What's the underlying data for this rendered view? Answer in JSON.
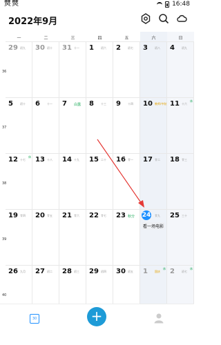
{
  "status": {
    "left_text": "㸈 㸈",
    "time": "16:48"
  },
  "header": {
    "title": "2022年9月"
  },
  "weekdays": [
    "一",
    "二",
    "三",
    "四",
    "五",
    "六",
    "日"
  ],
  "week_numbers": [
    "36",
    "37",
    "38",
    "39",
    "40"
  ],
  "cells": [
    {
      "day": "29",
      "lunar": "初九",
      "dim": true
    },
    {
      "day": "30",
      "lunar": "初十",
      "dim": true
    },
    {
      "day": "31",
      "lunar": "十一",
      "dim": true
    },
    {
      "day": "1",
      "lunar": "初六"
    },
    {
      "day": "2",
      "lunar": "初七"
    },
    {
      "day": "3",
      "lunar": "初八"
    },
    {
      "day": "4",
      "lunar": "初九"
    },
    {
      "day": "5",
      "lunar": "初十"
    },
    {
      "day": "6",
      "lunar": "十一"
    },
    {
      "day": "7",
      "lunar": "白露",
      "lunar_style": "green"
    },
    {
      "day": "8",
      "lunar": "十三"
    },
    {
      "day": "9",
      "lunar": "十四"
    },
    {
      "day": "10",
      "lunar": "教师/中秋",
      "lunar_style": "orange"
    },
    {
      "day": "11",
      "lunar": "十六",
      "tag": "休"
    },
    {
      "day": "12",
      "lunar": "十七",
      "tag": "休"
    },
    {
      "day": "13",
      "lunar": "十八"
    },
    {
      "day": "14",
      "lunar": "十九"
    },
    {
      "day": "15",
      "lunar": "二十"
    },
    {
      "day": "16",
      "lunar": "廿一"
    },
    {
      "day": "17",
      "lunar": "廿二"
    },
    {
      "day": "18",
      "lunar": "廿三"
    },
    {
      "day": "19",
      "lunar": "廿四"
    },
    {
      "day": "20",
      "lunar": "廿五"
    },
    {
      "day": "21",
      "lunar": "廿六"
    },
    {
      "day": "22",
      "lunar": "廿七"
    },
    {
      "day": "23",
      "lunar": "秋分",
      "lunar_style": "green"
    },
    {
      "day": "24",
      "lunar": "廿九",
      "today": true,
      "event": "看一场电影"
    },
    {
      "day": "25",
      "lunar": "三十"
    },
    {
      "day": "26",
      "lunar": "九月"
    },
    {
      "day": "27",
      "lunar": "初二"
    },
    {
      "day": "28",
      "lunar": "初三"
    },
    {
      "day": "29",
      "lunar": "初四"
    },
    {
      "day": "30",
      "lunar": "初五"
    },
    {
      "day": "1",
      "lunar": "国庆",
      "lunar_style": "orange",
      "tag": "休",
      "dim": true
    },
    {
      "day": "2",
      "lunar": "初七",
      "tag": "休",
      "dim": true
    }
  ],
  "bottom": {
    "calendar_day": "30",
    "add_label": "+"
  },
  "colors": {
    "accent": "#1e90ff",
    "add": "#1e9bd7",
    "festival_green": "#27ae60",
    "festival_orange": "#e6a400"
  },
  "icons": {
    "settings": "gear-icon",
    "search": "search-icon",
    "cloud": "cloud-icon",
    "calendar": "calendar-icon",
    "add": "plus-icon",
    "profile": "person-icon"
  }
}
